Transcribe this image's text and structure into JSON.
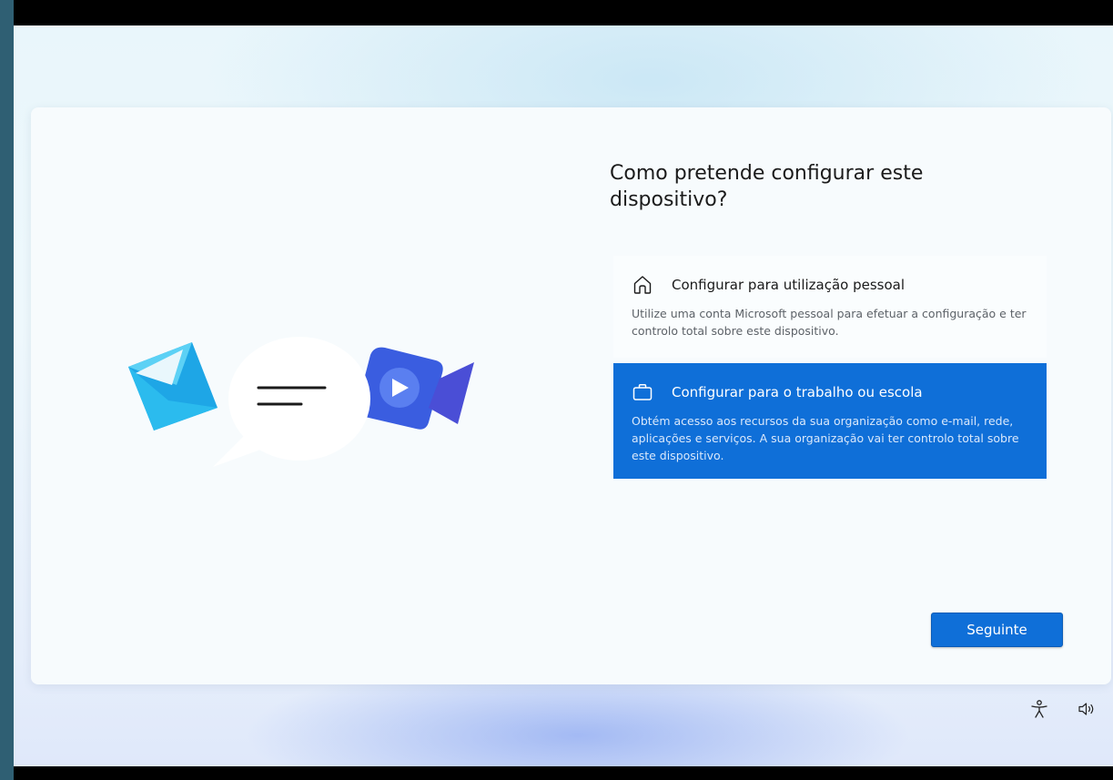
{
  "page": {
    "title": "Como pretende configurar este dispositivo?"
  },
  "options": [
    {
      "icon": "home-icon",
      "label": "Configurar para utilização pessoal",
      "description": "Utilize uma conta Microsoft pessoal para efetuar a configuração e ter controlo total sobre este dispositivo.",
      "selected": false
    },
    {
      "icon": "briefcase-icon",
      "label": "Configurar para o trabalho ou escola",
      "description": "Obtém acesso aos recursos da sua organização como e-mail, rede, aplicações e serviços. A sua organização vai ter controlo total sobre este dispositivo.",
      "selected": true
    }
  ],
  "buttons": {
    "next_label": "Seguinte"
  },
  "tray": {
    "icons": [
      "accessibility-icon",
      "volume-icon"
    ]
  },
  "colors": {
    "accent": "#0f6fd8",
    "card_bg": "#f7fbfd",
    "title_text": "#1b1b1b"
  }
}
